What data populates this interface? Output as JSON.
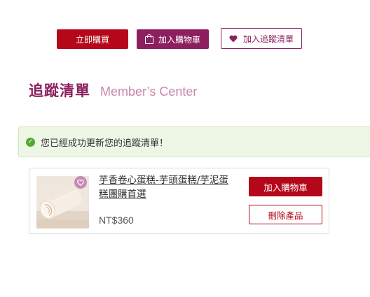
{
  "actions": {
    "buy_now_label": "立即購買",
    "add_to_cart_label": "加入購物車",
    "add_to_wishlist_label": "加入追蹤清單"
  },
  "heading": {
    "title": "追蹤清單",
    "subtitle": "Member’s Center"
  },
  "alert": {
    "message": "您已經成功更新您的追蹤清單！"
  },
  "wishlist": {
    "item": {
      "name": "芋香卷心蛋糕-芋頭蛋糕/芋泥蛋糕團購首選",
      "price": "NT$360",
      "add_to_cart_label": "加入購物車",
      "remove_label": "刪除產品"
    }
  },
  "colors": {
    "primary_red": "#b4081a",
    "brand_plum": "#8c1f5e",
    "subtitle_pink": "#c885a9",
    "success_bg": "#eef7e6",
    "success_icon": "#55a830"
  },
  "icons": {
    "cart": "shopping-bag-icon",
    "wishlist": "heart-icon",
    "alert": "check-circle-icon"
  }
}
